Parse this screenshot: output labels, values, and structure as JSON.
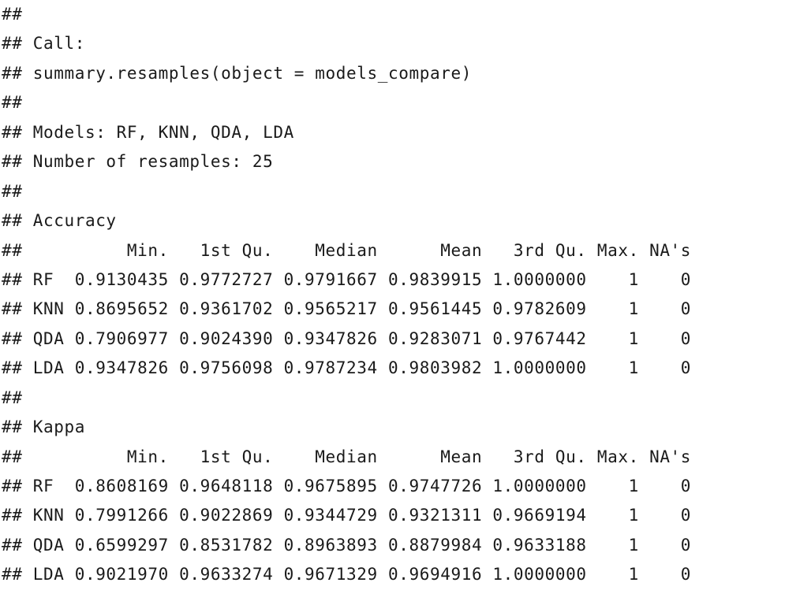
{
  "console": {
    "lines": [
      "##",
      "## Call:",
      "## summary.resamples(object = models_compare)",
      "##",
      "## Models: RF, KNN, QDA, LDA",
      "## Number of resamples: 25",
      "##",
      "## Accuracy",
      "##          Min.   1st Qu.    Median      Mean   3rd Qu. Max. NA's",
      "## RF  0.9130435 0.9772727 0.9791667 0.9839915 1.0000000    1    0",
      "## KNN 0.8695652 0.9361702 0.9565217 0.9561445 0.9782609    1    0",
      "## QDA 0.7906977 0.9024390 0.9347826 0.9283071 0.9767442    1    0",
      "## LDA 0.9347826 0.9756098 0.9787234 0.9803982 1.0000000    1    0",
      "##",
      "## Kappa",
      "##          Min.   1st Qu.    Median      Mean   3rd Qu. Max. NA's",
      "## RF  0.8608169 0.9648118 0.9675895 0.9747726 1.0000000    1    0",
      "## KNN 0.7991266 0.9022869 0.9344729 0.9321311 0.9669194    1    0",
      "## QDA 0.6599297 0.8531782 0.8963893 0.8879984 0.9633188    1    0",
      "## LDA 0.9021970 0.9633274 0.9671329 0.9694916 1.0000000    1    0"
    ]
  }
}
